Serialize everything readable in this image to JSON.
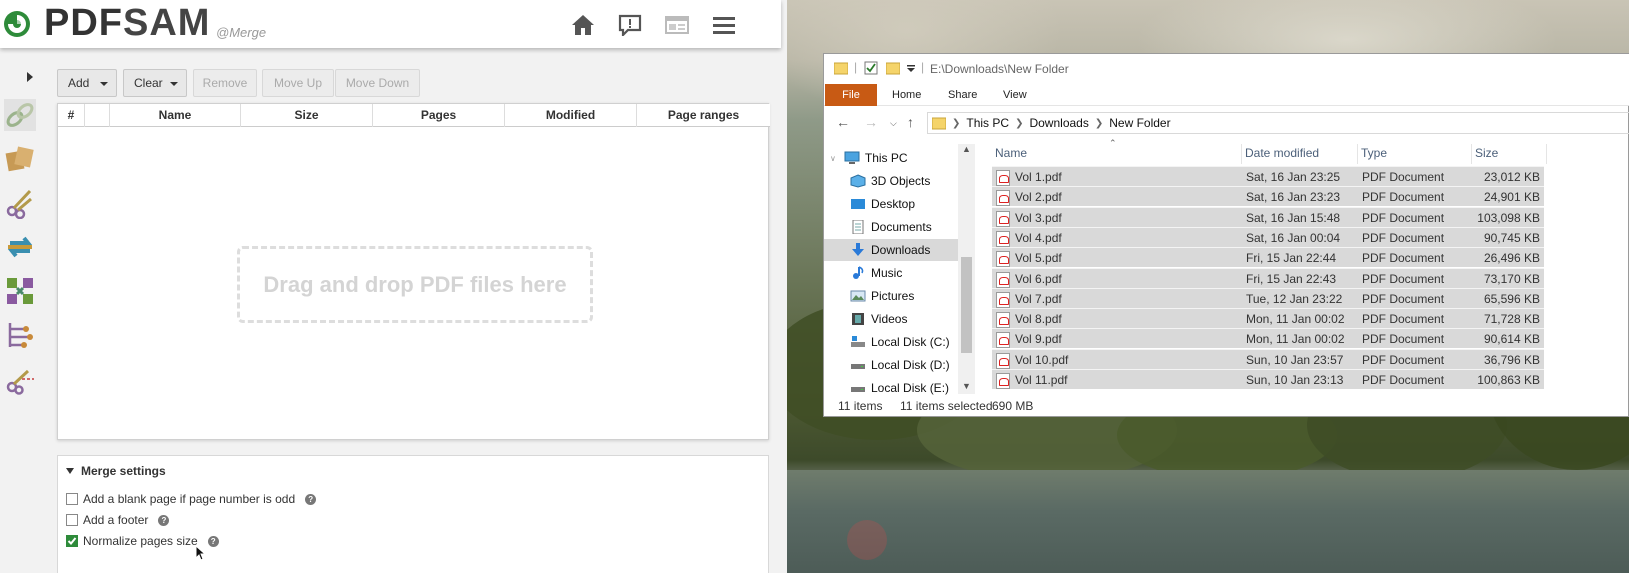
{
  "pdfsam": {
    "logo": {
      "brand": "PDFSAM",
      "brand_a": "PDF",
      "brand_b": "SAM",
      "module": "@Merge"
    },
    "header_icons": [
      "home-icon",
      "feedback-icon",
      "news-icon",
      "menu-icon"
    ],
    "toolbar": {
      "add": "Add",
      "clear": "Clear",
      "remove": "Remove",
      "move_up": "Move Up",
      "move_down": "Move Down"
    },
    "table": {
      "columns": [
        "#",
        "",
        "Name",
        "Size",
        "Pages",
        "Modified",
        "Page ranges"
      ],
      "dropzone": "Drag and drop PDF files here"
    },
    "settings": {
      "title": "Merge settings",
      "options": [
        {
          "label": "Add a blank page if page number is odd",
          "checked": false
        },
        {
          "label": "Add a footer",
          "checked": false
        },
        {
          "label": "Normalize pages size",
          "checked": true
        }
      ]
    },
    "tools": [
      "merge-tool-icon",
      "alternate-mix-tool-icon",
      "split-tool-icon",
      "rotate-tool-icon",
      "extract-tool-icon",
      "split-by-bookmarks-tool-icon",
      "split-by-size-tool-icon"
    ],
    "colors": {
      "accent": "#2e8b3a"
    }
  },
  "explorer": {
    "title": "E:\\Downloads\\New Folder",
    "ribbon": [
      "File",
      "Home",
      "Share",
      "View"
    ],
    "breadcrumb": [
      "This PC",
      "Downloads",
      "New Folder"
    ],
    "nav": [
      {
        "label": "This PC",
        "icon": "computer-icon"
      },
      {
        "label": "3D Objects",
        "icon": "3d-objects-icon"
      },
      {
        "label": "Desktop",
        "icon": "desktop-icon"
      },
      {
        "label": "Documents",
        "icon": "documents-icon"
      },
      {
        "label": "Downloads",
        "icon": "downloads-icon"
      },
      {
        "label": "Music",
        "icon": "music-icon"
      },
      {
        "label": "Pictures",
        "icon": "pictures-icon"
      },
      {
        "label": "Videos",
        "icon": "videos-icon"
      },
      {
        "label": "Local Disk (C:)",
        "icon": "drive-icon"
      },
      {
        "label": "Local Disk (D:)",
        "icon": "drive-icon"
      },
      {
        "label": "Local Disk (E:)",
        "icon": "drive-icon"
      }
    ],
    "columns": {
      "name": "Name",
      "date": "Date modified",
      "type": "Type",
      "size": "Size"
    },
    "files": [
      {
        "name": "Vol 1.pdf",
        "date": "Sat, 16 Jan 23:25",
        "type": "PDF Document",
        "size": "23,012 KB"
      },
      {
        "name": "Vol 2.pdf",
        "date": "Sat, 16 Jan 23:23",
        "type": "PDF Document",
        "size": "24,901 KB"
      },
      {
        "name": "Vol 3.pdf",
        "date": "Sat, 16 Jan 15:48",
        "type": "PDF Document",
        "size": "103,098 KB"
      },
      {
        "name": "Vol 4.pdf",
        "date": "Sat, 16 Jan 00:04",
        "type": "PDF Document",
        "size": "90,745 KB"
      },
      {
        "name": "Vol 5.pdf",
        "date": "Fri, 15 Jan 22:44",
        "type": "PDF Document",
        "size": "26,496 KB"
      },
      {
        "name": "Vol 6.pdf",
        "date": "Fri, 15 Jan 22:43",
        "type": "PDF Document",
        "size": "73,170 KB"
      },
      {
        "name": "Vol 7.pdf",
        "date": "Tue, 12 Jan 23:22",
        "type": "PDF Document",
        "size": "65,596 KB"
      },
      {
        "name": "Vol 8.pdf",
        "date": "Mon, 11 Jan 00:02",
        "type": "PDF Document",
        "size": "71,728 KB"
      },
      {
        "name": "Vol 9.pdf",
        "date": "Mon, 11 Jan 00:02",
        "type": "PDF Document",
        "size": "90,614 KB"
      },
      {
        "name": "Vol 10.pdf",
        "date": "Sun, 10 Jan 23:57",
        "type": "PDF Document",
        "size": "36,796 KB"
      },
      {
        "name": "Vol 11.pdf",
        "date": "Sun, 10 Jan 23:13",
        "type": "PDF Document",
        "size": "100,863 KB"
      }
    ],
    "status": {
      "count": "11 items",
      "selected": "11 items selected",
      "size": "690 MB"
    }
  }
}
